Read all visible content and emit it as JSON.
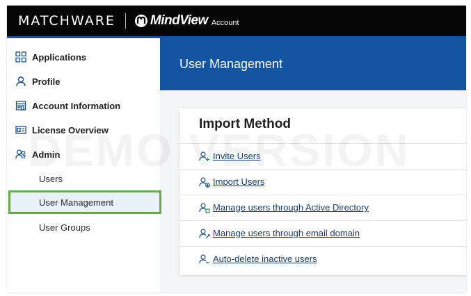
{
  "topbar": {
    "brand": "MATCHWARE",
    "product": "MindView",
    "product_sub": "Account"
  },
  "sidebar": {
    "items": [
      {
        "label": "Applications",
        "icon": "apps-grid-icon"
      },
      {
        "label": "Profile",
        "icon": "user-icon"
      },
      {
        "label": "Account Information",
        "icon": "building-icon"
      },
      {
        "label": "License Overview",
        "icon": "id-card-icon"
      },
      {
        "label": "Admin",
        "icon": "admin-users-icon"
      }
    ],
    "sub_items": [
      {
        "label": "Users",
        "active": false
      },
      {
        "label": "User Management",
        "active": true
      },
      {
        "label": "User Groups",
        "active": false
      }
    ]
  },
  "main": {
    "header_title": "User Management",
    "card_title": "Import Method",
    "options": [
      {
        "label": "Invite Users",
        "icon": "invite-user-icon"
      },
      {
        "label": "Import Users",
        "icon": "import-user-icon"
      },
      {
        "label": "Manage users through Active Directory",
        "icon": "directory-user-icon"
      },
      {
        "label": "Manage users through email domain",
        "icon": "email-user-icon"
      },
      {
        "label": "Auto-delete inactive users",
        "icon": "delete-user-icon"
      }
    ]
  },
  "watermark": "DEMO VERSION",
  "colors": {
    "topbar": "#050505",
    "header_band": "#1355a0",
    "active_border": "#6aa84f",
    "link": "#1a3d6d"
  }
}
